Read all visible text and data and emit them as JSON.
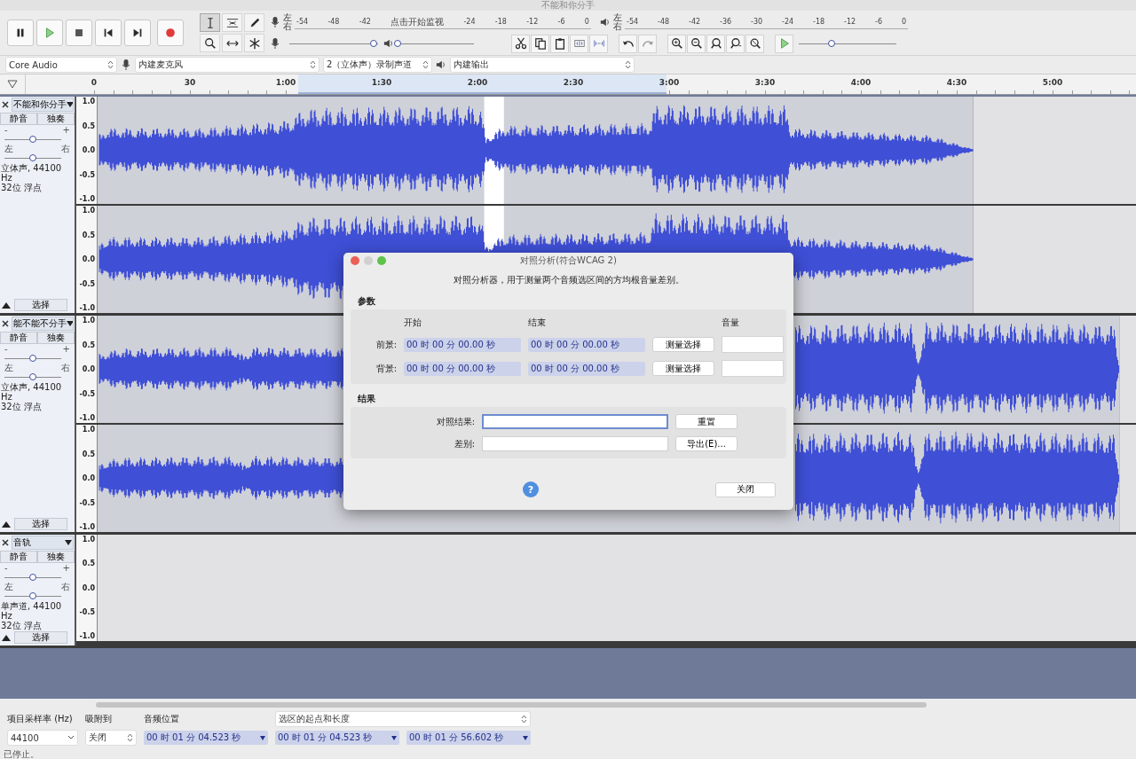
{
  "window": {
    "title": "不能和你分手"
  },
  "transport": [
    {
      "kind": "pause"
    },
    {
      "kind": "play"
    },
    {
      "kind": "stop"
    },
    {
      "kind": "skip-start"
    },
    {
      "kind": "skip-end"
    },
    {
      "kind": "record"
    }
  ],
  "tools": [
    {
      "kind": "select",
      "selected": true
    },
    {
      "kind": "envelope",
      "selected": false
    },
    {
      "kind": "draw",
      "selected": false
    },
    {
      "kind": "zoom",
      "selected": false
    },
    {
      "kind": "timeshift",
      "selected": false
    },
    {
      "kind": "multi",
      "selected": false
    }
  ],
  "record_meter": {
    "channel_labels": [
      "左",
      "右"
    ],
    "ticks": [
      "-54",
      "-48",
      "-42",
      "点击开始监视",
      "-24",
      "-18",
      "-12",
      "-6",
      "0"
    ]
  },
  "playback_meter": {
    "channel_labels": [
      "左",
      "右"
    ],
    "ticks": [
      "-54",
      "-48",
      "-42",
      "-36",
      "-30",
      "-24",
      "-18",
      "-12",
      "-6",
      "0"
    ]
  },
  "record_volume": {
    "level": 1.0
  },
  "playback_volume": {
    "level": 0.0
  },
  "edit_tools": [
    {
      "kind": "cut"
    },
    {
      "kind": "copy"
    },
    {
      "kind": "paste"
    },
    {
      "kind": "trim"
    },
    {
      "kind": "silence"
    },
    {
      "kind": "undo"
    },
    {
      "kind": "redo"
    },
    {
      "kind": "zoom-in"
    },
    {
      "kind": "zoom-out"
    },
    {
      "kind": "fit-selection"
    },
    {
      "kind": "fit-project"
    },
    {
      "kind": "zoom-toggle"
    },
    {
      "kind": "play-at-speed"
    }
  ],
  "play_speed": {
    "level": 0.33
  },
  "devices": {
    "host": "Core Audio",
    "input": "内建麦克风",
    "channels": "2（立体声）录制声道",
    "output": "内建输出"
  },
  "ruler": {
    "labels": [
      "0",
      "30",
      "1:00",
      "1:30",
      "2:00",
      "2:30",
      "3:00",
      "3:30",
      "4:00",
      "4:30",
      "5:00"
    ]
  },
  "tracks": [
    {
      "name": "不能和你分手",
      "mute": "静音",
      "solo": "独奏",
      "gain": {
        "minus": "-",
        "plus": "+",
        "level": 0.5
      },
      "pan": {
        "left": "左",
        "right": "右",
        "level": 0.5
      },
      "info": [
        "立体声, 44100 Hz",
        "32位 浮点"
      ],
      "select": "选择",
      "channels": [
        {
          "kind": "wave",
          "scale": [
            "1.0",
            "0.5",
            "0.0",
            "-0.5",
            "-1.0"
          ]
        },
        {
          "kind": "wave",
          "scale": [
            "1.0",
            "0.5",
            "0.0",
            "-0.5",
            "-1.0"
          ]
        }
      ]
    },
    {
      "name": "能不能不分手",
      "mute": "静音",
      "solo": "独奏",
      "gain": {
        "minus": "-",
        "plus": "+",
        "level": 0.5
      },
      "pan": {
        "left": "左",
        "right": "右",
        "level": 0.5
      },
      "info": [
        "立体声, 44100 Hz",
        "32位 浮点"
      ],
      "select": "选择",
      "channels": [
        {
          "kind": "wave",
          "scale": [
            "1.0",
            "0.5",
            "0.0",
            "-0.5",
            "-1.0"
          ]
        },
        {
          "kind": "wave",
          "scale": [
            "1.0",
            "0.5",
            "0.0",
            "-0.5",
            "-1.0"
          ]
        }
      ]
    },
    {
      "name": "音轨",
      "mute": "静音",
      "solo": "独奏",
      "gain": {
        "minus": "-",
        "plus": "+",
        "level": 0.5
      },
      "pan": {
        "left": "左",
        "right": "右",
        "level": 0.5
      },
      "info": [
        "单声道, 44100 Hz",
        "32位 浮点"
      ],
      "select": "选择",
      "channels": [
        {
          "kind": "empty",
          "scale": [
            "1.0",
            "0.5",
            "0.0",
            "-0.5",
            "-1.0"
          ]
        }
      ]
    }
  ],
  "dialog": {
    "title": "对照分析(符合WCAG 2)",
    "description": "对照分析器，用于测量两个音频选区间的方均根音量差别。",
    "params_label": "参数",
    "headers": [
      "开始",
      "结束",
      "音量"
    ],
    "rows": [
      {
        "label": "前景:",
        "start": "00 时 00 分 00.00 秒",
        "end": "00 时 00 分 00.00 秒",
        "button": "测量选择"
      },
      {
        "label": "背景:",
        "start": "00 时 00 分 00.00 秒",
        "end": "00 时 00 分 00.00 秒",
        "button": "测量选择"
      }
    ],
    "results_label": "结果",
    "results": [
      {
        "label": "对照结果:",
        "focused": true,
        "button": "重置"
      },
      {
        "label": "差别:",
        "focused": false,
        "button": "导出(E)..."
      }
    ],
    "help": "?",
    "close": "关闭"
  },
  "selection_toolbar": {
    "rate_label": "项目采样率 (Hz)",
    "snap_label": "吸附到",
    "position_label": "音频位置",
    "selection_mode": "选区的起点和长度",
    "rate": "44100",
    "snap": "关闭",
    "position": "00 时 01 分 04.523 秒",
    "start": "00 时 01 分 04.523 秒",
    "length": "00 时 01 分 56.602 秒"
  },
  "status": "已停止。"
}
